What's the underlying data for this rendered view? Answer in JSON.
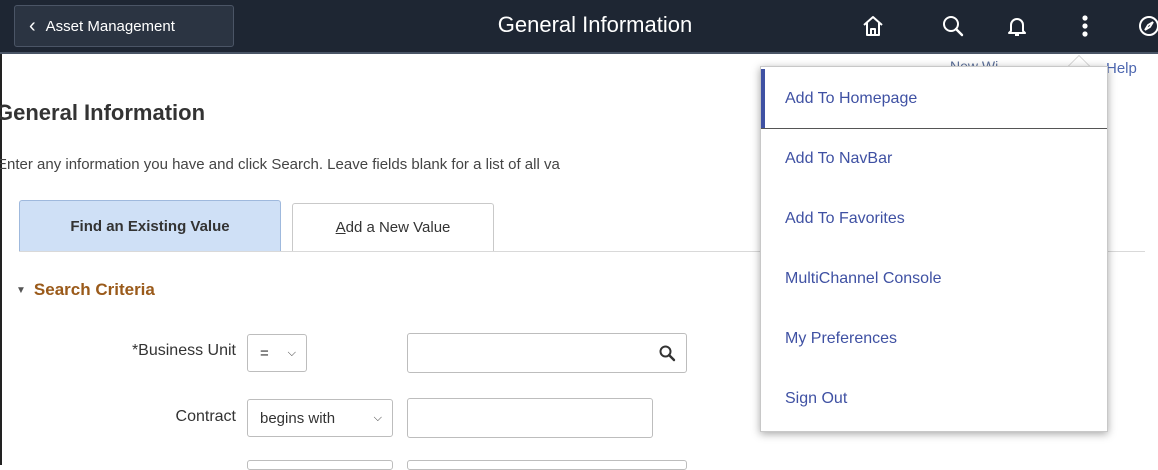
{
  "header": {
    "back_label": "Asset Management",
    "title": "General Information",
    "icons": [
      "home-icon",
      "search-icon",
      "bell-icon",
      "more-vertical-icon",
      "compass-icon"
    ]
  },
  "subbar": {
    "partial_links": "New Wi",
    "help": "Help"
  },
  "page": {
    "title": "General Information",
    "instructions": "Enter any information you have and click Search. Leave fields blank for a list of all va"
  },
  "tabs": [
    {
      "label": "Find an Existing Value",
      "active": true
    },
    {
      "label_access_key": "A",
      "label_rest": "dd a New Value",
      "active": false
    }
  ],
  "search_criteria": {
    "title": "Search Criteria",
    "fields": [
      {
        "label": "*Business Unit",
        "operator": "=",
        "value": ""
      },
      {
        "label": "Contract",
        "operator": "begins with",
        "value": ""
      }
    ]
  },
  "actions_menu": {
    "items": [
      "Add To Homepage",
      "Add To NavBar",
      "Add To Favorites",
      "MultiChannel Console",
      "My Preferences",
      "Sign Out"
    ]
  },
  "colors": {
    "header_bg": "#1e2633",
    "menu_link": "#3f51a3",
    "active_tab_bg": "#cfe0f6",
    "section_title": "#9a5a1a"
  }
}
